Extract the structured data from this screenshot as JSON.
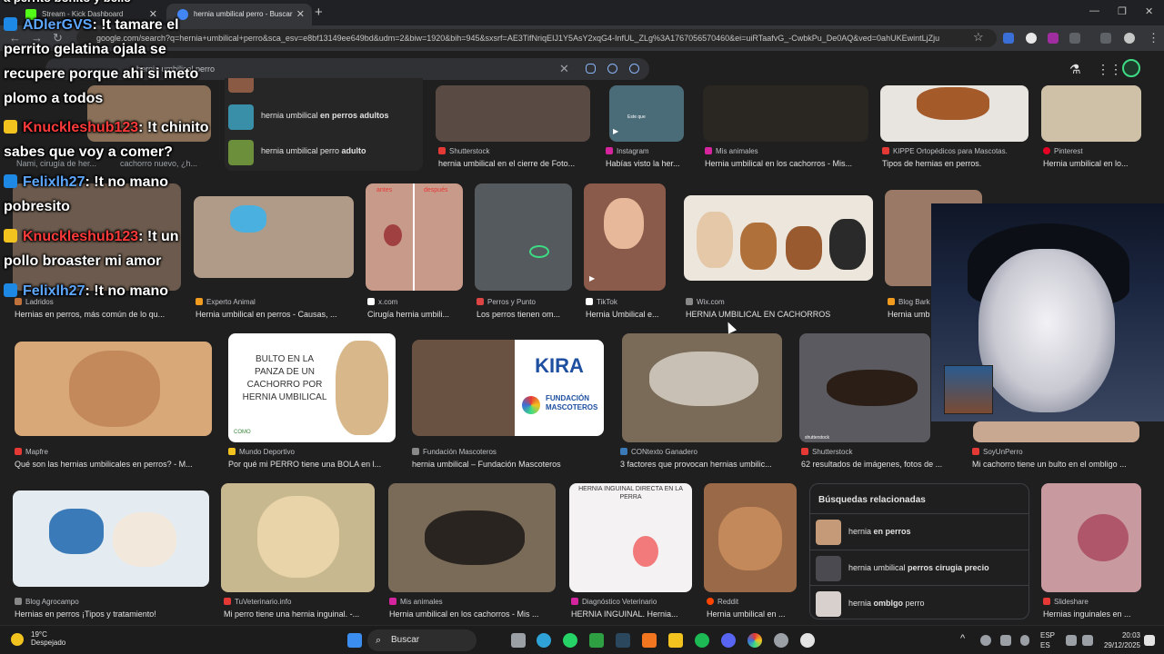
{
  "tabs": [
    {
      "label": "Stream - Kick Dashboard",
      "color": "#53fc18"
    },
    {
      "label": "hernia umbilical perro - Buscar",
      "color": "#4285f4"
    }
  ],
  "address": {
    "url": "google.com/search?q=hernia+umbilical+perro&sca_esv=e8bf13149ee649bd&udm=2&biw=1920&bih=945&sxsrf=AE3TifNriqEIJ1Y5AsY2xqG4-InfUL_ZLg%3A1767056570460&ei=uiRTaafvG_-CwbkPu_De0AQ&ved=0ahUKEwintLjZju"
  },
  "search": {
    "query": "hernia umbilical perro"
  },
  "suggestions": [
    {
      "prefix": "hernia umbilical ",
      "bold": "en perros adultos",
      "color": "#3a8fa8"
    },
    {
      "prefix": "hernia umbilical perro ",
      "bold": "adulto",
      "color": "#6b8f3a"
    }
  ],
  "rows": [
    [
      {
        "source": "Shutterstock",
        "caption": "hernia umbilical en el cierre de Foto...",
        "fav": "#e53935",
        "img": "#5a4a44"
      },
      {
        "source": "Instagram",
        "caption": "Habías visto la her...",
        "fav": "#d6249f",
        "img": "#4a6b78"
      },
      {
        "source": "Mis animales",
        "caption": "Hernia umbilical en los cachorros - Mis...",
        "fav": "#d6249f",
        "img": "#2a2622"
      },
      {
        "source": "KIPPE Ortopédicos para Mascotas.",
        "caption": "Tipos de hernias en perros.",
        "fav": "#e53935",
        "img": "#e8e4df"
      },
      {
        "source": "Pinterest",
        "caption": "Hernia umbilical en lo...",
        "fav": "#e60023",
        "img": "#cfc0a8"
      }
    ],
    [
      {
        "source": "Ladridos",
        "caption": "Hernias en perros, más común de lo qu...",
        "fav": "#c0723a",
        "img": "#6b5a4d"
      },
      {
        "source": "Experto Animal",
        "caption": "Hernia umbilical en perros - Causas, ...",
        "fav": "#f29c1f",
        "img": "#b09a88"
      },
      {
        "source": "x.com",
        "caption": "Cirugía hernia umbili...",
        "fav": "#ffffff",
        "img": "#c89a8a"
      },
      {
        "source": "Perros y Punto",
        "caption": "Los perros tienen om...",
        "fav": "#d44",
        "img": "#555a5e"
      },
      {
        "source": "TikTok",
        "caption": "Hernia Umbilical e...",
        "fav": "#ffffff",
        "img": "#8a5a4a"
      },
      {
        "source": "Wix.com",
        "caption": "HERNIA UMBILICAL EN CACHORROS",
        "fav": "#888888",
        "img": "#ece6dc"
      },
      {
        "source": "Blog Bark",
        "caption": "Hernia umb",
        "fav": "#f29c1f",
        "img": "#9a7a66"
      }
    ],
    [
      {
        "source": "Mapfre",
        "caption": "Qué son las hernias umbilicales en perros? - M...",
        "fav": "#e53935",
        "img": "#d8a878"
      },
      {
        "source": "Mundo Deportivo",
        "caption": "Por qué mi PERRO tiene una BOLA en l...",
        "fav": "#f2c21f",
        "img": "#ffffff"
      },
      {
        "source": "Fundación Mascoteros",
        "caption": "hernia umbilical – Fundación Mascoteros",
        "fav": "#888888",
        "img": "#6a5242"
      },
      {
        "source": "CONtexto Ganadero",
        "caption": "3 factores que provocan hernias umbilic...",
        "fav": "#3a7ab8",
        "img": "#7a6a58"
      },
      {
        "source": "Shutterstock",
        "caption": "62 resultados de imágenes, fotos de ...",
        "fav": "#e53935",
        "img": "#5a5a60"
      },
      {
        "source": "SoyUnPerro",
        "caption": "Mi cachorro tiene un bulto en el ombligo ...",
        "fav": "#e53935",
        "img": "#c8a890"
      }
    ],
    [
      {
        "source": "Blog Agrocampo",
        "caption": "Hernias en perros ¡Tipos y tratamiento!",
        "fav": "#888888",
        "img": "#e4ecf2"
      },
      {
        "source": "TuVeterinario.info",
        "caption": "Mi perro tiene una hernia inguinal. -...",
        "fav": "#e53935",
        "img": "#c8b890"
      },
      {
        "source": "Mis animales",
        "caption": "Hernia umbilical en los cachorros - Mis ...",
        "fav": "#d6249f",
        "img": "#7a6a58"
      },
      {
        "source": "Diagnóstico Veterinario",
        "caption": "HERNIA INGUINAL. Hernia...",
        "fav": "#d6249f",
        "img": "#f4f2f2"
      },
      {
        "source": "Reddit",
        "caption": "Hernia umbilical en ...",
        "fav": "#ff4500",
        "img": "#9a6a48"
      },
      {
        "source": "Slideshare",
        "caption": "Hernias inguinales en ...",
        "fav": "#e53935",
        "img": "#c89aa0"
      }
    ]
  ],
  "thumb_text": {
    "arrow_top": "antes",
    "arrow_right": "después",
    "bulto": "BULTO EN LA PANZA DE UN CACHORRO POR HERNIA UMBILICAL",
    "kira": "KIRA",
    "fundacion": "FUNDACIÓN MASCOTEROS",
    "inguinal": "HERNIA INGUINAL DIRECTA EN LA PERRA",
    "como": "COMO",
    "shutterstock_wm": "shutterstock",
    "este_que": "Este que"
  },
  "related": {
    "title": "Búsquedas relacionadas",
    "items": [
      {
        "prefix": "hernia ",
        "bold": "en perros",
        "suffix": "",
        "color": "#c49a78"
      },
      {
        "prefix": "hernia umbilical ",
        "bold": "perros cirugia precio",
        "suffix": "",
        "color": "#4a4a50"
      },
      {
        "prefix": "hernia ",
        "bold": "omblgo",
        "suffix": " perro",
        "color": "#d8d0cc"
      }
    ]
  },
  "chat": [
    {
      "user": "ADlerGVS",
      "text": ": !t tamare el",
      "cont": [
        "perrito gelatina ojala se",
        "recupere porque ahi si meto",
        "plomo a todos"
      ],
      "color": "blue"
    },
    {
      "user": "Knuckleshub123",
      "text": ": !t chinito",
      "cont": [
        "sabes que voy a comer?"
      ],
      "color": "red"
    },
    {
      "user": "Felixlh27",
      "text": ": !t no mano",
      "cont": [
        "pobresito"
      ],
      "color": "blue"
    },
    {
      "user": "Knuckleshub123",
      "text": ": !t un",
      "cont": [
        "pollo broaster mi amor"
      ],
      "color": "red"
    },
    {
      "user": "Felixlh27",
      "text": ": !t no mano",
      "cont": [],
      "color": "blue"
    }
  ],
  "chat_top_partial": "a perrito bonito y bello",
  "hidden_behind_chat": {
    "cap1": "Nami, cirugía de her...",
    "cap2": "cachorro nuevo, ¿h..."
  },
  "taskbar": {
    "temp": "19°C",
    "weather": "Despejado",
    "search": "Buscar",
    "lang1": "ESP",
    "lang2": "ES",
    "time": "20:03",
    "date": "29/12/2025"
  }
}
